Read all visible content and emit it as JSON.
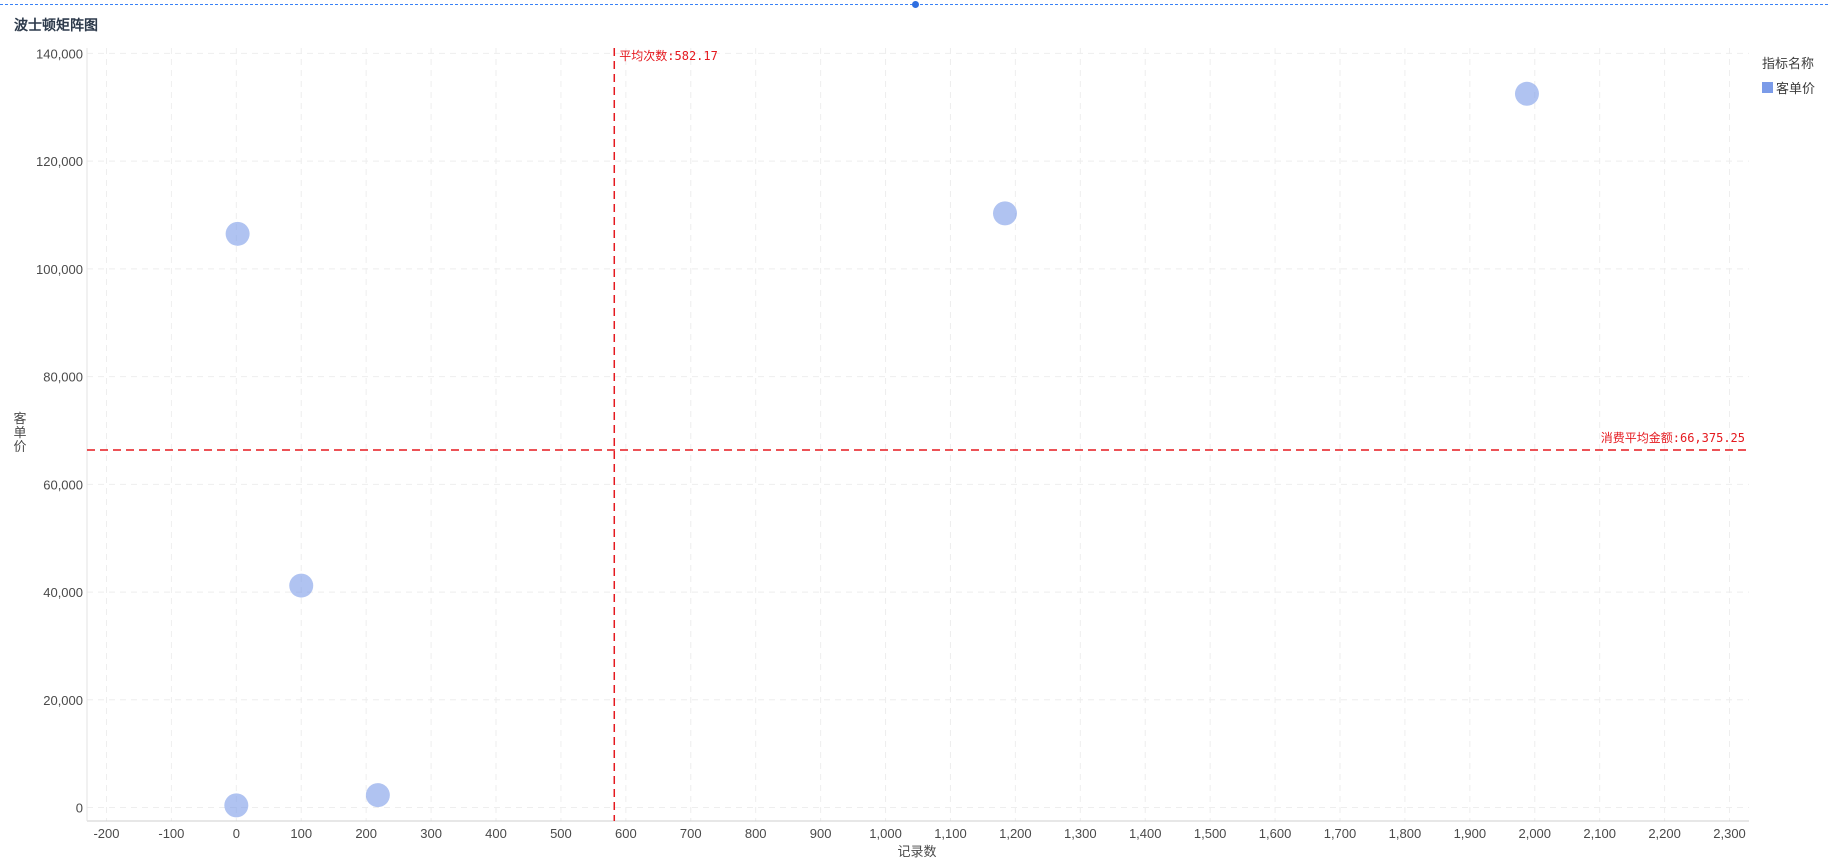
{
  "chart_title": "波士顿矩阵图",
  "legend": {
    "title": "指标名称",
    "items": [
      {
        "label": "客单价",
        "color": "#7b9be8"
      }
    ]
  },
  "chart_data": {
    "type": "scatter",
    "title": "波士顿矩阵图",
    "xlabel": "记录数",
    "ylabel": "客单价",
    "xlim": [
      -230,
      2330
    ],
    "ylim": [
      -2500,
      141000
    ],
    "x_ticks": [
      -200,
      -100,
      0,
      100,
      200,
      300,
      400,
      500,
      600,
      700,
      800,
      900,
      1000,
      1100,
      1200,
      1300,
      1400,
      1500,
      1600,
      1700,
      1800,
      1900,
      2000,
      2100,
      2200,
      2300
    ],
    "x_tick_labels": [
      "-200",
      "-100",
      "0",
      "100",
      "200",
      "300",
      "400",
      "500",
      "600",
      "700",
      "800",
      "900",
      "1,000",
      "1,100",
      "1,200",
      "1,300",
      "1,400",
      "1,500",
      "1,600",
      "1,700",
      "1,800",
      "1,900",
      "2,000",
      "2,100",
      "2,200",
      "2,300"
    ],
    "y_ticks": [
      0,
      20000,
      40000,
      60000,
      80000,
      100000,
      120000,
      140000
    ],
    "y_tick_labels": [
      "0",
      "20,000",
      "40,000",
      "60,000",
      "80,000",
      "100,000",
      "120,000",
      "140,000"
    ],
    "grid": true,
    "legend_position": "top-right",
    "series": [
      {
        "name": "客单价",
        "color": "#7b9be8",
        "points": [
          {
            "x": 2,
            "y": 106500
          },
          {
            "x": 0,
            "y": 400
          },
          {
            "x": 100,
            "y": 41200
          },
          {
            "x": 218,
            "y": 2300
          },
          {
            "x": 1184,
            "y": 110300
          },
          {
            "x": 1988,
            "y": 132500
          }
        ]
      }
    ],
    "reference_lines": [
      {
        "axis": "x",
        "value": 582.17,
        "label": "平均次数:582.17",
        "color": "#e5191f"
      },
      {
        "axis": "y",
        "value": 66375.25,
        "label": "消费平均金额:66,375.25",
        "color": "#e5191f"
      }
    ]
  }
}
